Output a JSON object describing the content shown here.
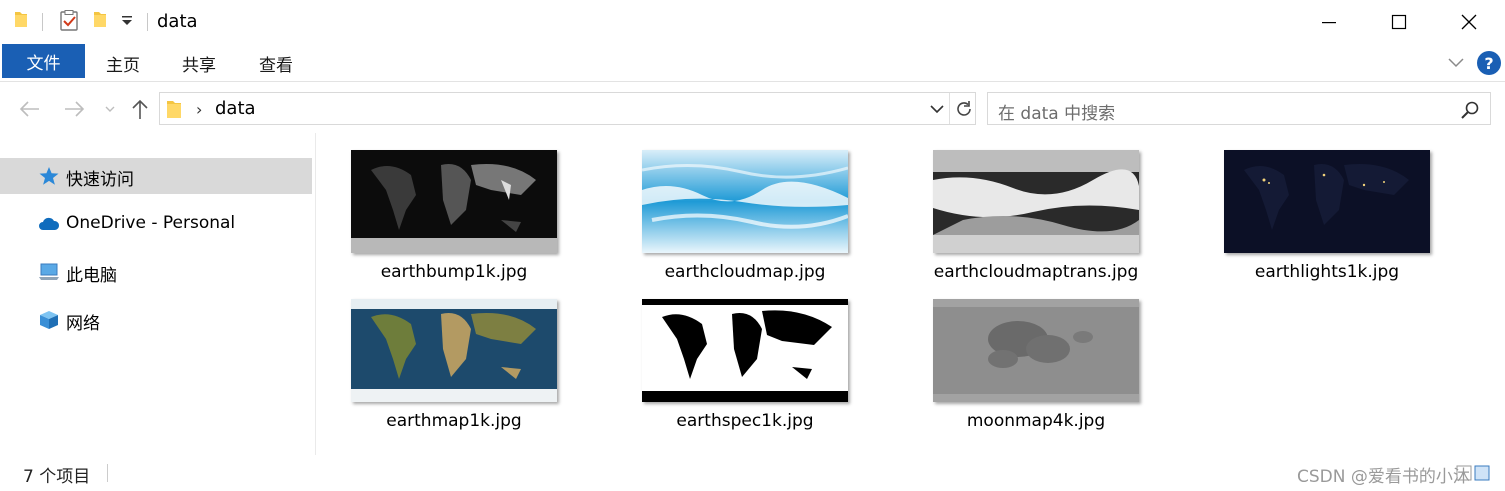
{
  "window": {
    "title": "data",
    "controls": [
      "minimize-icon",
      "maximize-icon",
      "close-icon"
    ]
  },
  "ribbon": {
    "file_tab": "文件",
    "tabs": [
      "主页",
      "共享",
      "查看"
    ],
    "help": "?"
  },
  "address": {
    "path": "data",
    "separator": "›"
  },
  "search": {
    "placeholder": "在 data 中搜索"
  },
  "nav": {
    "items": [
      {
        "label": "快速访问",
        "icon": "star-icon",
        "selected": true
      },
      {
        "label": "OneDrive - Personal",
        "icon": "cloud-icon",
        "selected": false
      },
      {
        "label": "此电脑",
        "icon": "computer-icon",
        "selected": false
      },
      {
        "label": "网络",
        "icon": "network-icon",
        "selected": false
      }
    ]
  },
  "files": [
    {
      "name": "earthbump1k.jpg",
      "style": "bump"
    },
    {
      "name": "earthcloudmap.jpg",
      "style": "cloud"
    },
    {
      "name": "earthcloudmaptrans.jpg",
      "style": "cloudtrans"
    },
    {
      "name": "earthlights1k.jpg",
      "style": "lights"
    },
    {
      "name": "earthmap1k.jpg",
      "style": "map"
    },
    {
      "name": "earthspec1k.jpg",
      "style": "spec"
    },
    {
      "name": "moonmap4k.jpg",
      "style": "moon"
    }
  ],
  "status": {
    "count": "7 个项目",
    "watermark": "CSDN @爱看书的小沐"
  },
  "colors": {
    "accent": "#1a5fb4",
    "selected_bg": "#d9d9d9"
  }
}
